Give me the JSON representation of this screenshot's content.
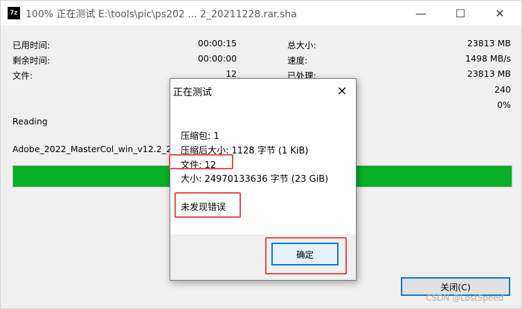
{
  "window": {
    "icon_text": "7z",
    "title": "100% 正在测试 E:\\tools\\pic\\ps202 ... 2_20211228.rar.sha"
  },
  "stats_left": [
    {
      "label": "已用时间:",
      "value": "00:00:15"
    },
    {
      "label": "剩余时间:",
      "value": "00:00:00"
    },
    {
      "label": "文件:",
      "value": "12"
    }
  ],
  "stats_right": [
    {
      "label": "总大小:",
      "value": "23813 MB"
    },
    {
      "label": "速度:",
      "value": "1498 MB/s"
    },
    {
      "label": "已处理:",
      "value": "23813 MB"
    },
    {
      "label": "",
      "value": "240"
    },
    {
      "label": "",
      "value": "0%"
    }
  ],
  "status": "Reading",
  "current_file": "Adobe_2022_MasterCol_win_v12.2_20",
  "progress": {
    "percent": 100,
    "color": "#06b025"
  },
  "close_button": "关闭(C)",
  "watermark": "CSDN @LostSpeed",
  "dialog": {
    "title": "正在测试",
    "lines": [
      "压缩包:  1",
      "压缩后大小: 1128 字节 (1 KiB)",
      "文件: 12",
      "大小: 24970133636 字节 (23 GiB)"
    ],
    "result": "未发现错误",
    "ok_button": "确定"
  },
  "highlight_color": "#e44b4b",
  "accent_color": "#0078d7"
}
